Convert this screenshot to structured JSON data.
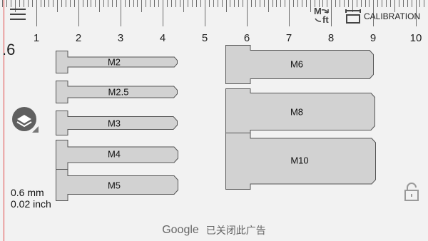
{
  "ruler": {
    "labels": [
      "1",
      "2",
      "3",
      "4",
      "5",
      "6",
      "7",
      "8",
      "9",
      "10"
    ],
    "partial_label": ".6"
  },
  "toolbar": {
    "menu_icon": "hamburger-menu-icon",
    "unit_switch_m": "M",
    "unit_switch_ft": "ft",
    "calibration_label": "CALIBRATION"
  },
  "screws": [
    {
      "label": "M2"
    },
    {
      "label": "M2.5"
    },
    {
      "label": "M3"
    },
    {
      "label": "M4"
    },
    {
      "label": "M5"
    },
    {
      "label": "M6"
    },
    {
      "label": "M8"
    },
    {
      "label": "M10"
    }
  ],
  "measurement": {
    "mm": "0.6 mm",
    "inch": "0.02 inch"
  },
  "ad": {
    "brand": "Google",
    "close_text": "已关闭此广告"
  },
  "colors": {
    "screw_fill": "#d2d2d2",
    "screw_stroke": "#555555",
    "zero_line": "#e24848",
    "background": "#f2f2f2"
  }
}
